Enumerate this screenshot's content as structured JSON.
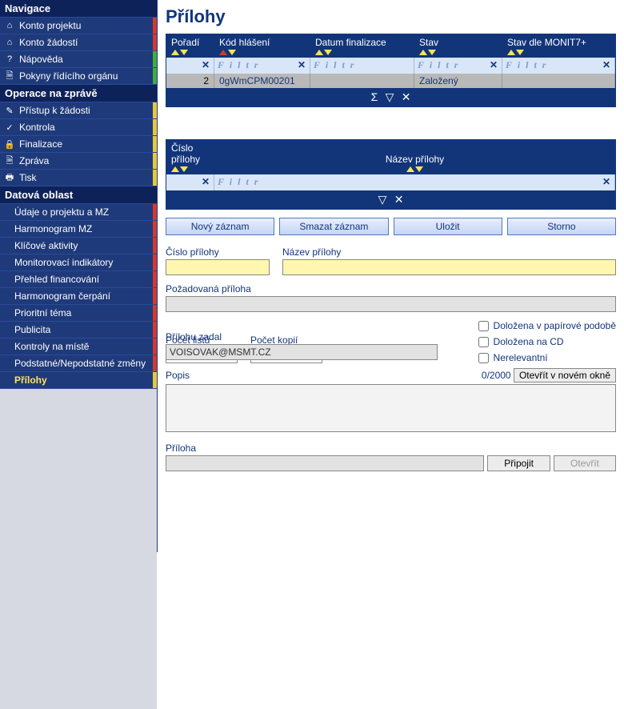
{
  "sidebar": {
    "groups": [
      {
        "title": "Navigace",
        "items": [
          {
            "label": "Konto projektu",
            "icon": "⌂",
            "mark": "red"
          },
          {
            "label": "Konto žádostí",
            "icon": "⌂",
            "mark": "red"
          },
          {
            "label": "Nápověda",
            "icon": "?",
            "mark": "green"
          },
          {
            "label": "Pokyny řídícího orgánu",
            "icon": "🗎",
            "mark": "green"
          }
        ]
      },
      {
        "title": "Operace na zprávě",
        "items": [
          {
            "label": "Přístup k žádosti",
            "icon": "✎",
            "mark": "yellow"
          },
          {
            "label": "Kontrola",
            "icon": "✓",
            "mark": "yellow"
          },
          {
            "label": "Finalizace",
            "icon": "🔒",
            "mark": "yellow"
          },
          {
            "label": "Zpráva",
            "icon": "🗎",
            "mark": "yellow"
          },
          {
            "label": "Tisk",
            "icon": "🖶",
            "mark": "yellow"
          }
        ]
      },
      {
        "title": "Datová oblast",
        "items": [
          {
            "label": "Údaje o projektu a MZ",
            "mark": "red"
          },
          {
            "label": "Harmonogram MZ",
            "mark": "red"
          },
          {
            "label": "Klíčové aktivity",
            "mark": "red"
          },
          {
            "label": "Monitorovací indikátory",
            "mark": "red"
          },
          {
            "label": "Přehled financování",
            "mark": "red"
          },
          {
            "label": "Harmonogram čerpání",
            "mark": "red"
          },
          {
            "label": "Prioritní téma",
            "mark": "red"
          },
          {
            "label": "Publicita",
            "mark": "red"
          },
          {
            "label": "Kontroly na místě",
            "mark": "red"
          },
          {
            "label": "Podstatné/Nepodstatné změny",
            "mark": "red"
          },
          {
            "label": "Přílohy",
            "mark": "yellow",
            "active": true
          }
        ]
      }
    ]
  },
  "page": {
    "title": "Přílohy"
  },
  "grid1": {
    "headers": [
      "Pořadí",
      "Kód hlášení",
      "Datum finalizace",
      "Stav",
      "Stav dle MONIT7+"
    ],
    "filter_placeholder": "F i l t r",
    "row": {
      "poradi": "2",
      "kod": "0gWmCPM00201",
      "datum": "",
      "stav": "Založený",
      "monit": ""
    }
  },
  "grid2": {
    "headers": [
      "Číslo přílohy",
      "Název přílohy"
    ],
    "filter_placeholder": "F i l t r"
  },
  "buttons": {
    "novy": "Nový záznam",
    "smazat": "Smazat záznam",
    "ulozit": "Uložit",
    "storno": "Storno"
  },
  "form": {
    "cislo_label": "Číslo přílohy",
    "nazev_label": "Název přílohy",
    "pozad_label": "Požadovaná příloha",
    "listu_label": "Počet listů",
    "kopii_label": "Počet kopií",
    "chk_papir": "Doložena v papírové podobě",
    "chk_cd": "Doložena na CD",
    "chk_nerel": "Nerelevantní",
    "zadal_label": "Přílohu zadal",
    "zadal_value": "VOISOVAK@MSMT.CZ",
    "popis_label": "Popis",
    "counter": "0/2000",
    "open_new": "Otevřít v novém okně",
    "priloha_label": "Příloha",
    "pripojit": "Připojit",
    "otevrit": "Otevřít"
  }
}
